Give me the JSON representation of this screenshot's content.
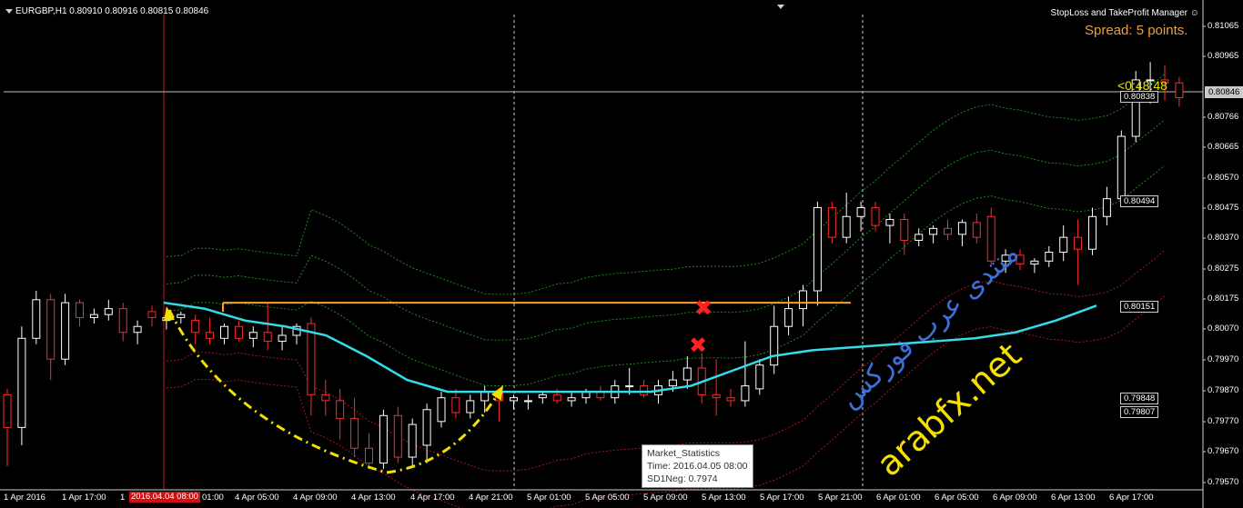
{
  "header": {
    "symbol_info": "EURGBP,H1  0.80910 0.80916 0.80815 0.80846"
  },
  "expert": {
    "name": "StopLoss and TakeProfit Manager",
    "icon": "smiley-icon"
  },
  "spread_label": "Spread: 5 points.",
  "countdown": "<0:48:48",
  "price_axis": [
    "0.81065",
    "0.80965",
    "0.80766",
    "0.80665",
    "0.80570",
    "0.80475",
    "0.80370",
    "0.80275",
    "0.80175",
    "0.80070",
    "0.79970",
    "0.79870",
    "0.79770",
    "0.79670",
    "0.79570"
  ],
  "price_tags": {
    "current": "0.80846",
    "level1": "0.80838",
    "level2": "0.80494",
    "level3": "0.80151",
    "level4": "0.79848",
    "level5": "0.79807"
  },
  "time_axis": [
    "1 Apr 2016",
    "1 Apr 17:00",
    "1",
    "01:00",
    "4 Apr 05:00",
    "4 Apr 09:00",
    "4 Apr 13:00",
    "4 Apr 17:00",
    "4 Apr 21:00",
    "5 Apr 01:00",
    "5 Apr 05:00",
    "5 Apr 09:00",
    "5 Apr 13:00",
    "5 Apr 17:00",
    "5 Apr 21:00",
    "6 Apr 01:00",
    "6 Apr 05:00",
    "6 Apr 09:00",
    "6 Apr 13:00",
    "6 Apr 17:00"
  ],
  "time_highlight": "2016.04.04 08:00",
  "tooltip": {
    "title": "Market_Statistics",
    "time": "Time: 2016.04.05 08:00",
    "value": "SD1Neg: 0.7974"
  },
  "watermark": {
    "arabic": "منتدى عرب فوركس",
    "domain": "arabfx.net"
  },
  "colors": {
    "background": "#000000",
    "bull": "#ffffff",
    "bear": "#ff2a2a",
    "cyan_line": "#33dde8",
    "orange_line": "#ffa020",
    "arrow": "#f2e000",
    "green_band": "#1c8a1c",
    "red_band": "#a01818"
  },
  "chart_data": {
    "type": "candlestick",
    "symbol": "EURGBP",
    "timeframe": "H1",
    "ohlc_header": {
      "open": 0.8091,
      "high": 0.80916,
      "low": 0.80815,
      "close": 0.80846
    },
    "ylim": [
      0.7953,
      0.8113
    ],
    "candles": [
      {
        "o": 0.7985,
        "h": 0.7987,
        "l": 0.7961,
        "c": 0.7974
      },
      {
        "o": 0.7974,
        "h": 0.8008,
        "l": 0.7968,
        "c": 0.8004
      },
      {
        "o": 0.8004,
        "h": 0.802,
        "l": 0.8002,
        "c": 0.8017
      },
      {
        "o": 0.8017,
        "h": 0.8019,
        "l": 0.799,
        "c": 0.7997
      },
      {
        "o": 0.7997,
        "h": 0.8019,
        "l": 0.7995,
        "c": 0.8016
      },
      {
        "o": 0.8016,
        "h": 0.8017,
        "l": 0.8008,
        "c": 0.8011
      },
      {
        "o": 0.8011,
        "h": 0.8014,
        "l": 0.8009,
        "c": 0.8012
      },
      {
        "o": 0.8012,
        "h": 0.8017,
        "l": 0.801,
        "c": 0.8014
      },
      {
        "o": 0.8014,
        "h": 0.8016,
        "l": 0.8003,
        "c": 0.8006
      },
      {
        "o": 0.8006,
        "h": 0.801,
        "l": 0.8002,
        "c": 0.8008
      },
      {
        "o": 0.8013,
        "h": 0.8015,
        "l": 0.8008,
        "c": 0.8011
      },
      {
        "o": 0.801,
        "h": 0.8013,
        "l": 0.8007,
        "c": 0.8011
      },
      {
        "o": 0.8011,
        "h": 0.8013,
        "l": 0.8009,
        "c": 0.8012
      },
      {
        "o": 0.801,
        "h": 0.8012,
        "l": 0.8002,
        "c": 0.8006
      },
      {
        "o": 0.8006,
        "h": 0.8011,
        "l": 0.8002,
        "c": 0.8004
      },
      {
        "o": 0.8004,
        "h": 0.8009,
        "l": 0.8002,
        "c": 0.8008
      },
      {
        "o": 0.8008,
        "h": 0.801,
        "l": 0.8003,
        "c": 0.8004
      },
      {
        "o": 0.8004,
        "h": 0.8008,
        "l": 0.8001,
        "c": 0.8006
      },
      {
        "o": 0.8006,
        "h": 0.8016,
        "l": 0.8,
        "c": 0.8003
      },
      {
        "o": 0.8003,
        "h": 0.8008,
        "l": 0.8,
        "c": 0.8005
      },
      {
        "o": 0.8005,
        "h": 0.8009,
        "l": 0.8002,
        "c": 0.8008
      },
      {
        "o": 0.8009,
        "h": 0.8011,
        "l": 0.7978,
        "c": 0.7985
      },
      {
        "o": 0.7985,
        "h": 0.799,
        "l": 0.7978,
        "c": 0.7983
      },
      {
        "o": 0.7983,
        "h": 0.7987,
        "l": 0.797,
        "c": 0.7977
      },
      {
        "o": 0.7977,
        "h": 0.7984,
        "l": 0.7964,
        "c": 0.7967
      },
      {
        "o": 0.7967,
        "h": 0.7972,
        "l": 0.796,
        "c": 0.7962
      },
      {
        "o": 0.7962,
        "h": 0.798,
        "l": 0.796,
        "c": 0.7978
      },
      {
        "o": 0.7978,
        "h": 0.7981,
        "l": 0.7962,
        "c": 0.7964
      },
      {
        "o": 0.7964,
        "h": 0.7977,
        "l": 0.7961,
        "c": 0.7975
      },
      {
        "o": 0.7968,
        "h": 0.7982,
        "l": 0.7962,
        "c": 0.798
      },
      {
        "o": 0.7976,
        "h": 0.7986,
        "l": 0.7974,
        "c": 0.7984
      },
      {
        "o": 0.7984,
        "h": 0.7987,
        "l": 0.7977,
        "c": 0.7979
      },
      {
        "o": 0.7979,
        "h": 0.7985,
        "l": 0.7977,
        "c": 0.7983
      },
      {
        "o": 0.7983,
        "h": 0.7988,
        "l": 0.7979,
        "c": 0.7986
      },
      {
        "o": 0.7986,
        "h": 0.7987,
        "l": 0.7976,
        "c": 0.7983
      },
      {
        "o": 0.7983,
        "h": 0.7985,
        "l": 0.798,
        "c": 0.7984
      },
      {
        "o": 0.7983,
        "h": 0.7985,
        "l": 0.798,
        "c": 0.7983
      },
      {
        "o": 0.7984,
        "h": 0.7986,
        "l": 0.7982,
        "c": 0.7985
      },
      {
        "o": 0.7985,
        "h": 0.7987,
        "l": 0.7982,
        "c": 0.7983
      },
      {
        "o": 0.7983,
        "h": 0.7986,
        "l": 0.7981,
        "c": 0.7984
      },
      {
        "o": 0.7984,
        "h": 0.7987,
        "l": 0.7982,
        "c": 0.7986
      },
      {
        "o": 0.7986,
        "h": 0.7988,
        "l": 0.7983,
        "c": 0.7984
      },
      {
        "o": 0.7984,
        "h": 0.799,
        "l": 0.7982,
        "c": 0.7988
      },
      {
        "o": 0.7988,
        "h": 0.7994,
        "l": 0.7985,
        "c": 0.7988
      },
      {
        "o": 0.7988,
        "h": 0.799,
        "l": 0.7984,
        "c": 0.7985
      },
      {
        "o": 0.7985,
        "h": 0.799,
        "l": 0.7982,
        "c": 0.7988
      },
      {
        "o": 0.7988,
        "h": 0.7993,
        "l": 0.7986,
        "c": 0.799
      },
      {
        "o": 0.799,
        "h": 0.7998,
        "l": 0.7987,
        "c": 0.7994
      },
      {
        "o": 0.7994,
        "h": 0.7999,
        "l": 0.7982,
        "c": 0.7985
      },
      {
        "o": 0.7985,
        "h": 0.7997,
        "l": 0.7978,
        "c": 0.7984
      },
      {
        "o": 0.7984,
        "h": 0.7987,
        "l": 0.7981,
        "c": 0.7983
      },
      {
        "o": 0.7983,
        "h": 0.8003,
        "l": 0.7981,
        "c": 0.7988
      },
      {
        "o": 0.7987,
        "h": 0.7997,
        "l": 0.7985,
        "c": 0.7995
      },
      {
        "o": 0.7995,
        "h": 0.8015,
        "l": 0.7992,
        "c": 0.8008
      },
      {
        "o": 0.8008,
        "h": 0.8018,
        "l": 0.8005,
        "c": 0.8014
      },
      {
        "o": 0.8014,
        "h": 0.8022,
        "l": 0.8008,
        "c": 0.802
      },
      {
        "o": 0.802,
        "h": 0.805,
        "l": 0.8015,
        "c": 0.8048
      },
      {
        "o": 0.8048,
        "h": 0.805,
        "l": 0.8036,
        "c": 0.8038
      },
      {
        "o": 0.8038,
        "h": 0.8053,
        "l": 0.8036,
        "c": 0.8045
      },
      {
        "o": 0.8045,
        "h": 0.805,
        "l": 0.804,
        "c": 0.8048
      },
      {
        "o": 0.8048,
        "h": 0.805,
        "l": 0.804,
        "c": 0.8042
      },
      {
        "o": 0.8042,
        "h": 0.8046,
        "l": 0.8036,
        "c": 0.8044
      },
      {
        "o": 0.8044,
        "h": 0.8046,
        "l": 0.8032,
        "c": 0.8037
      },
      {
        "o": 0.8037,
        "h": 0.8041,
        "l": 0.8035,
        "c": 0.8039
      },
      {
        "o": 0.8039,
        "h": 0.8042,
        "l": 0.8036,
        "c": 0.8041
      },
      {
        "o": 0.8041,
        "h": 0.8044,
        "l": 0.8037,
        "c": 0.8039
      },
      {
        "o": 0.8039,
        "h": 0.8044,
        "l": 0.8035,
        "c": 0.8043
      },
      {
        "o": 0.8043,
        "h": 0.8046,
        "l": 0.8036,
        "c": 0.8038
      },
      {
        "o": 0.8045,
        "h": 0.8048,
        "l": 0.8028,
        "c": 0.803
      },
      {
        "o": 0.803,
        "h": 0.8034,
        "l": 0.8026,
        "c": 0.8032
      },
      {
        "o": 0.8032,
        "h": 0.8034,
        "l": 0.8027,
        "c": 0.8029
      },
      {
        "o": 0.8029,
        "h": 0.8031,
        "l": 0.8026,
        "c": 0.803
      },
      {
        "o": 0.803,
        "h": 0.8035,
        "l": 0.8028,
        "c": 0.8033
      },
      {
        "o": 0.8033,
        "h": 0.8042,
        "l": 0.803,
        "c": 0.8038
      },
      {
        "o": 0.8038,
        "h": 0.8044,
        "l": 0.8022,
        "c": 0.8034
      },
      {
        "o": 0.8034,
        "h": 0.8048,
        "l": 0.8032,
        "c": 0.8045
      },
      {
        "o": 0.8045,
        "h": 0.8055,
        "l": 0.8042,
        "c": 0.8051
      },
      {
        "o": 0.8051,
        "h": 0.8074,
        "l": 0.8049,
        "c": 0.8072
      },
      {
        "o": 0.8072,
        "h": 0.8094,
        "l": 0.807,
        "c": 0.8091
      },
      {
        "o": 0.8091,
        "h": 0.8097,
        "l": 0.8083,
        "c": 0.8091
      },
      {
        "o": 0.8091,
        "h": 0.8096,
        "l": 0.8084,
        "c": 0.809
      },
      {
        "o": 0.809,
        "h": 0.8092,
        "l": 0.8082,
        "c": 0.8085
      }
    ],
    "annotations": {
      "orange_level": 0.8016,
      "x_marks": 2,
      "cyan_line": [
        0.8016,
        0.8014,
        0.801,
        0.8008,
        0.8005,
        0.7998,
        0.799,
        0.7986,
        0.7986,
        0.7986,
        0.7986,
        0.7986,
        0.7986,
        0.7988,
        0.7993,
        0.7998,
        0.8,
        0.8001,
        0.8002,
        0.8003,
        0.8004,
        0.8006,
        0.801,
        0.8015
      ]
    }
  }
}
